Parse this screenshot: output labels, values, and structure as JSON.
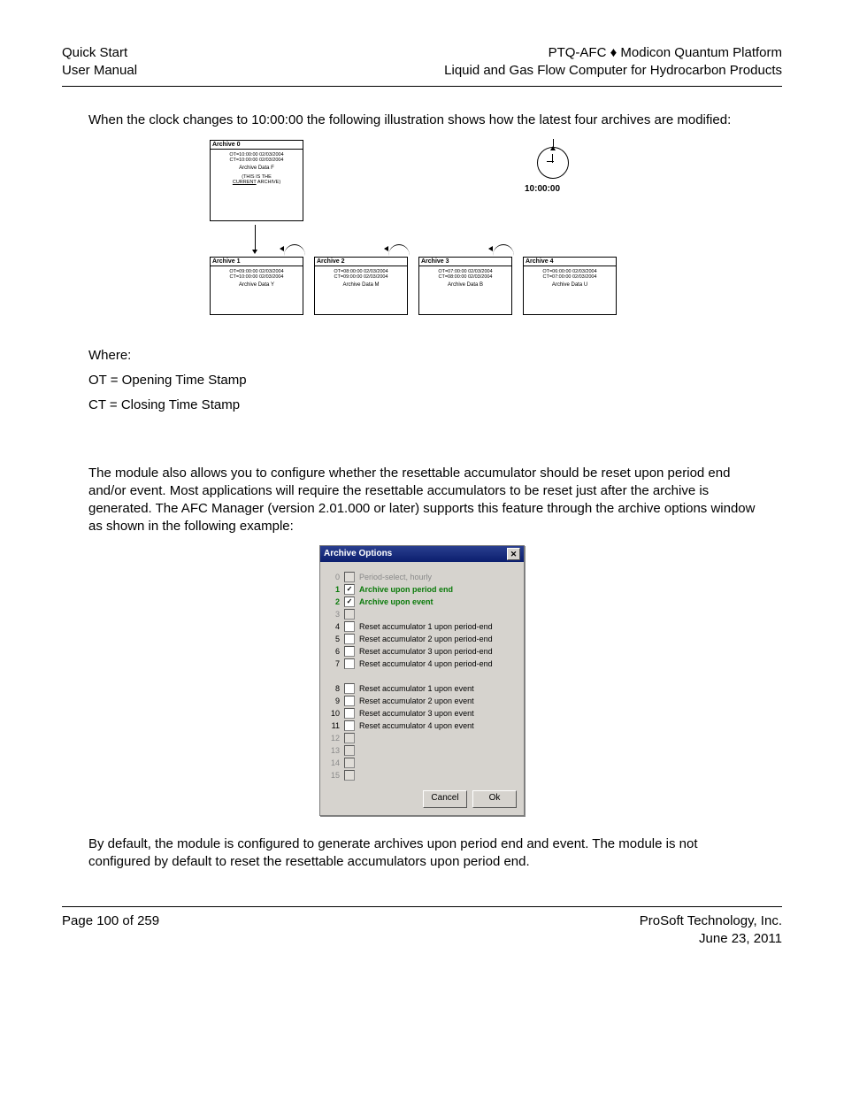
{
  "header": {
    "left1": "Quick Start",
    "left2": "User Manual",
    "right1": "PTQ-AFC ♦ Modicon Quantum Platform",
    "right2": "Liquid and Gas Flow Computer for Hydrocarbon Products"
  },
  "para1": "When the clock changes to 10:00:00 the following illustration shows how the latest four archives are modified:",
  "diagram": {
    "clock_time": "10:00:00",
    "arch0": {
      "title": "Archive 0",
      "ot": "OT=10:00:00 02/03/2004",
      "ct": "CT=10:00:00 02/03/2004",
      "data": "Archive Data F",
      "note1": "(THIS IS THE",
      "note2_a": "CURRENT",
      "note2_b": " ARCHIVE)"
    },
    "arch1": {
      "title": "Archive 1",
      "ot": "OT=09:00:00 02/03/2004",
      "ct": "CT=10:00:00 02/03/2004",
      "data": "Archive Data Y"
    },
    "arch2": {
      "title": "Archive 2",
      "ot": "OT=08:00:00 02/03/2004",
      "ct": "CT=09:00:00 02/03/2004",
      "data": "Archive Data M"
    },
    "arch3": {
      "title": "Archive 3",
      "ot": "OT=07:00:00 02/03/2004",
      "ct": "CT=08:00:00 02/03/2004",
      "data": "Archive Data B"
    },
    "arch4": {
      "title": "Archive 4",
      "ot": "OT=06:00:00 02/03/2004",
      "ct": "CT=07:00:00 02/03/2004",
      "data": "Archive Data U"
    }
  },
  "where": {
    "h": "Where:",
    "ot": "OT = Opening Time Stamp",
    "ct": "CT = Closing Time Stamp"
  },
  "para2": "The module also allows you to configure whether the resettable accumulator should be reset upon period end and/or event. Most applications will require the resettable accumulators to be reset just after the archive is generated. The AFC Manager (version 2.01.000 or later) supports this feature through the archive options window as shown in the following example:",
  "dialog": {
    "title": "Archive Options",
    "close": "✕",
    "rows": [
      {
        "n": "0",
        "label": "Period-select, hourly",
        "checked": false,
        "style": "dim"
      },
      {
        "n": "1",
        "label": "Archive upon period end",
        "checked": true,
        "style": "green"
      },
      {
        "n": "2",
        "label": "Archive upon event",
        "checked": true,
        "style": "green"
      },
      {
        "n": "3",
        "label": "",
        "checked": false,
        "style": "dim"
      },
      {
        "n": "4",
        "label": "Reset accumulator 1 upon period-end",
        "checked": false,
        "style": ""
      },
      {
        "n": "5",
        "label": "Reset accumulator 2 upon period-end",
        "checked": false,
        "style": ""
      },
      {
        "n": "6",
        "label": "Reset accumulator 3 upon period-end",
        "checked": false,
        "style": ""
      },
      {
        "n": "7",
        "label": "Reset accumulator 4 upon period-end",
        "checked": false,
        "style": ""
      }
    ],
    "rows2": [
      {
        "n": "8",
        "label": "Reset accumulator 1 upon event",
        "checked": false,
        "style": ""
      },
      {
        "n": "9",
        "label": "Reset accumulator 2 upon event",
        "checked": false,
        "style": ""
      },
      {
        "n": "10",
        "label": "Reset accumulator 3 upon event",
        "checked": false,
        "style": ""
      },
      {
        "n": "11",
        "label": "Reset accumulator 4 upon event",
        "checked": false,
        "style": ""
      },
      {
        "n": "12",
        "label": "",
        "checked": false,
        "style": "dim"
      },
      {
        "n": "13",
        "label": "",
        "checked": false,
        "style": "dim"
      },
      {
        "n": "14",
        "label": "",
        "checked": false,
        "style": "dim"
      },
      {
        "n": "15",
        "label": "",
        "checked": false,
        "style": "dim"
      }
    ],
    "btn_cancel": "Cancel",
    "btn_ok": "Ok"
  },
  "para3": "By default, the module is configured to generate archives upon period end and event. The module is not configured by default to reset the resettable accumulators upon period end.",
  "footer": {
    "left": "Page 100 of 259",
    "right1": "ProSoft Technology, Inc.",
    "right2": "June 23, 2011"
  }
}
